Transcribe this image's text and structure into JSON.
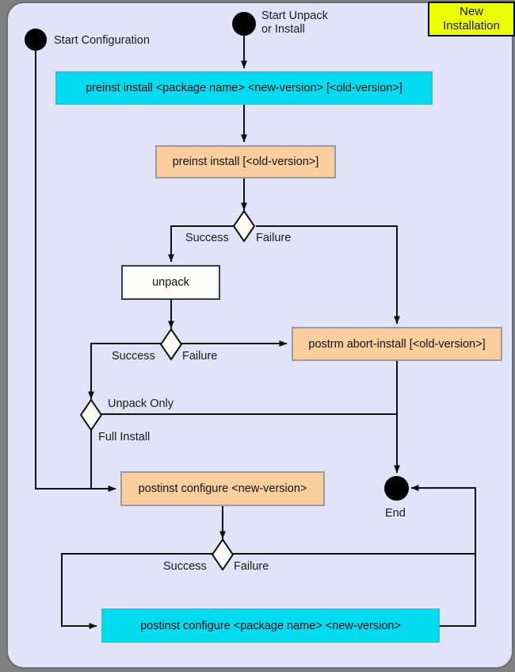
{
  "diagram": {
    "title_tag": "New\nInstallation",
    "title_tag_line1": "New",
    "title_tag_line2": "Installation",
    "background": "#e2e2f8",
    "frame_border": "#6b6b78",
    "colors": {
      "cyan_node": "#00dbf0",
      "orange_node": "#fbce9d",
      "white_node": "#fdfdfa",
      "title_tag": "#eaff00",
      "edge": "#111111"
    }
  },
  "start_nodes": [
    {
      "id": "start-configuration",
      "label": "Start Configuration"
    },
    {
      "id": "start-unpack-or-install",
      "label_line1": "Start Unpack",
      "label_line2": "or Install"
    }
  ],
  "end_node": {
    "id": "end",
    "label": "End"
  },
  "actions": [
    {
      "id": "preinst-install-full",
      "label": "preinst install <package name> <new-version> [<old-version>]",
      "style": "cyan"
    },
    {
      "id": "preinst-install-old",
      "label": "preinst install [<old-version>]",
      "style": "orange"
    },
    {
      "id": "unpack",
      "label": "unpack",
      "style": "white"
    },
    {
      "id": "postrm-abort-install",
      "label": "postrm abort-install [<old-version>]",
      "style": "orange"
    },
    {
      "id": "postinst-configure-new",
      "label": "postinst configure <new-version>",
      "style": "orange"
    },
    {
      "id": "postinst-configure-full",
      "label": "postinst configure <package name> <new-version>",
      "style": "cyan"
    }
  ],
  "decisions": [
    {
      "id": "decision-preinst",
      "branch_left": "Success",
      "branch_right": "Failure"
    },
    {
      "id": "decision-unpack",
      "branch_left": "Success",
      "branch_right": "Failure"
    },
    {
      "id": "decision-install-mode",
      "branch_top": "Unpack Only",
      "branch_bottom": "Full Install"
    },
    {
      "id": "decision-postinst",
      "branch_left": "Success",
      "branch_right": "Failure"
    }
  ],
  "edge_labels": [
    "Success",
    "Failure",
    "Success",
    "Failure",
    "Unpack Only",
    "Full Install",
    "Success",
    "Failure"
  ]
}
